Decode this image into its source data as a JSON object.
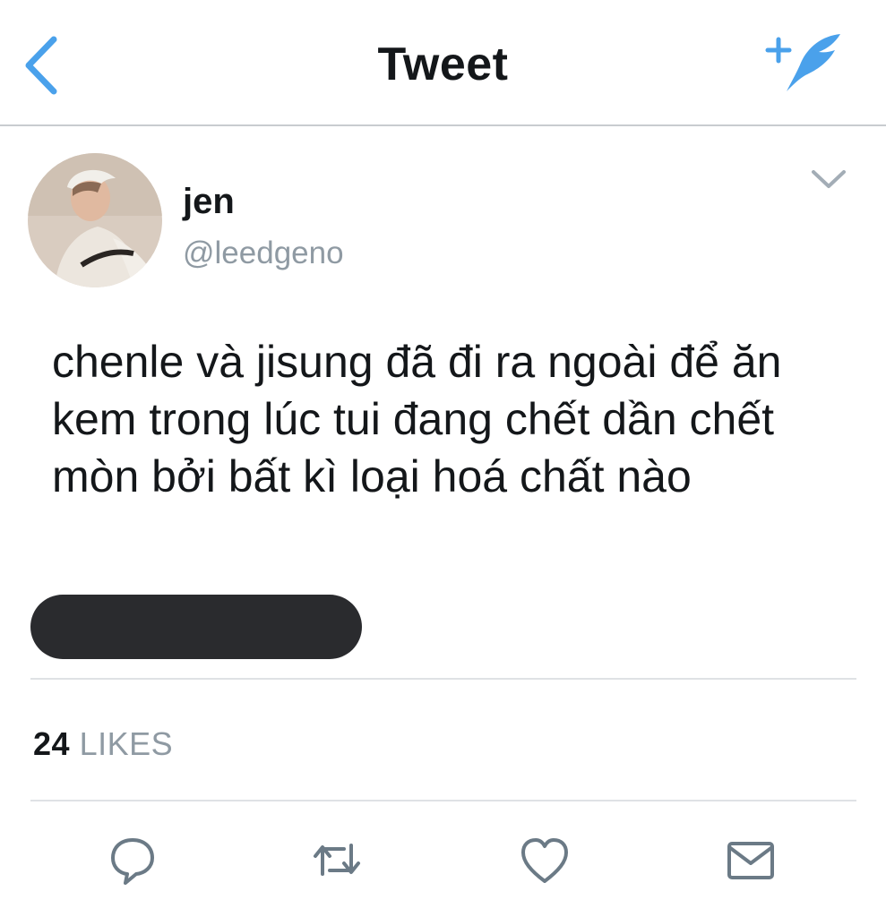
{
  "header": {
    "title": "Tweet",
    "back_icon": "chevron-left-icon",
    "compose_icon": "compose-tweet-icon",
    "accent_color": "#4aa1eb"
  },
  "tweet": {
    "author": {
      "display_name": "jen",
      "handle": "@leedgeno"
    },
    "text": "chenle và jisung đã đi ra ngoài để ăn kem trong lúc tui đang chết dần chết mòn bởi bất kì loại hoá chất nào",
    "stats": {
      "likes_count": "24",
      "likes_label": "LIKES"
    },
    "actions": [
      "reply-icon",
      "retweet-icon",
      "like-icon",
      "direct-message-icon"
    ]
  }
}
